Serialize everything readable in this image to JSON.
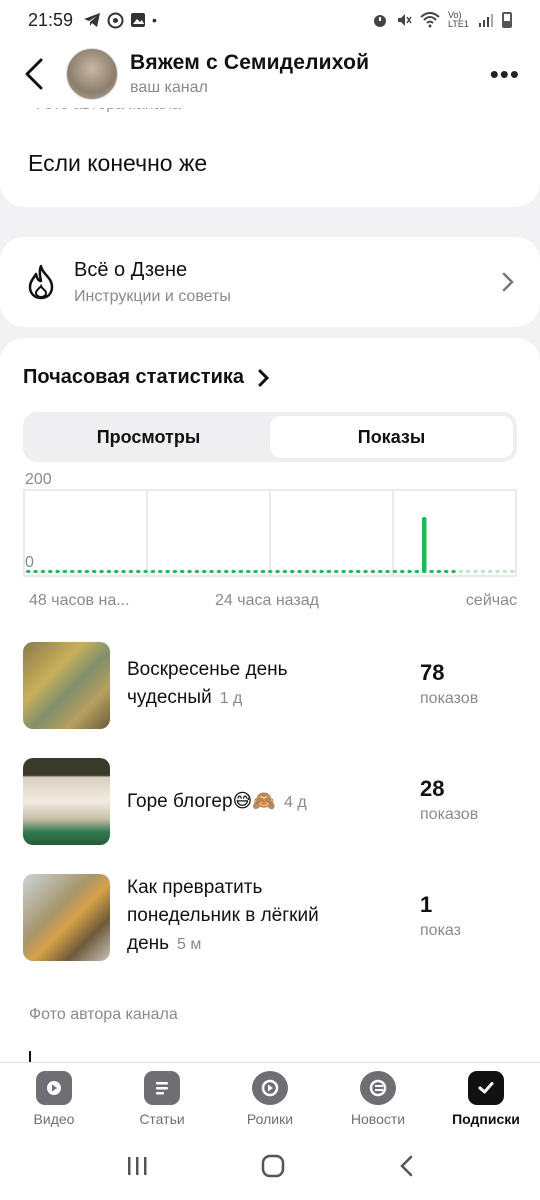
{
  "status_bar": {
    "time": "21:59",
    "network": "Vo) LTE1"
  },
  "header": {
    "title": "Вяжем с  Семиделихой",
    "subtitle": "ваш канал",
    "more": "•••"
  },
  "top_card": {
    "cut_caption": "Фото автора канала",
    "text": "Если конечно же"
  },
  "zen_card": {
    "title": "Всё о Дзене",
    "subtitle": "Инструкции и советы"
  },
  "stats": {
    "title": "Почасовая статистика",
    "tabs": [
      {
        "label": "Просмотры",
        "active": false
      },
      {
        "label": "Показы",
        "active": true
      }
    ],
    "x_labels": [
      "48 часов на...",
      "24 часа назад",
      "сейчас"
    ]
  },
  "chart_data": {
    "type": "bar",
    "ylim": [
      0,
      200
    ],
    "y_ticks": [
      "200",
      "0"
    ],
    "x_ticks": [
      "48 часов на...",
      "24 часа назад",
      "сейчас"
    ],
    "color": "#1db954",
    "faded_color": "#b7e6c6",
    "values": [
      2,
      2,
      2,
      2,
      2,
      2,
      2,
      2,
      2,
      2,
      2,
      2,
      2,
      2,
      2,
      2,
      2,
      2,
      2,
      2,
      2,
      2,
      2,
      3,
      3,
      6,
      6,
      2,
      2,
      2,
      2,
      2,
      2,
      2,
      2,
      2,
      2,
      2,
      2,
      2,
      2,
      2,
      2,
      2,
      2,
      2,
      2,
      2,
      2,
      2,
      2,
      2,
      2,
      2,
      140,
      3,
      3,
      3,
      2,
      2,
      2,
      2,
      2,
      2,
      2,
      2,
      2
    ],
    "faded_from_index": 59
  },
  "posts": [
    {
      "title": "Воскресенье день чудесный",
      "age": "1 д",
      "count": "78",
      "unit": "показов"
    },
    {
      "title": "Горе блогер😅🙈",
      "age": "4 д",
      "count": "28",
      "unit": "показов"
    },
    {
      "title": "Как превратить понедельник в лёгкий день",
      "age": "5 м",
      "count": "1",
      "unit": "показ"
    }
  ],
  "footer_caption": "Фото автора канала",
  "bottom_nav": [
    {
      "label": "Видео",
      "icon": "video-icon",
      "active": false
    },
    {
      "label": "Статьи",
      "icon": "articles-icon",
      "active": false
    },
    {
      "label": "Ролики",
      "icon": "clips-icon",
      "active": false
    },
    {
      "label": "Новости",
      "icon": "news-icon",
      "active": false
    },
    {
      "label": "Подписки",
      "icon": "subscriptions-icon",
      "active": true
    }
  ]
}
